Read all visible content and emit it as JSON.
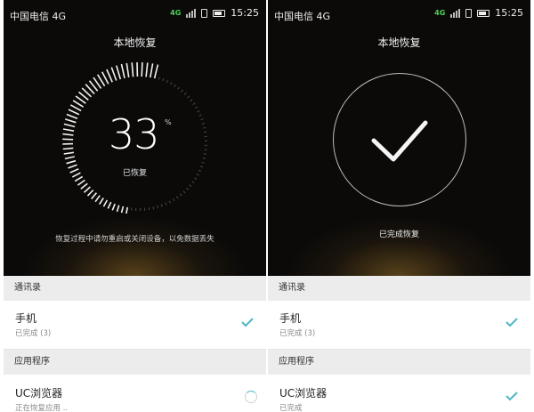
{
  "left_screen": {
    "status": {
      "carrier": "中国电信 4G",
      "network": "4G",
      "time": "15:25"
    },
    "title": "本地恢复",
    "progress": {
      "value": "33",
      "unit": "%",
      "label": "已恢复",
      "percent": 33
    },
    "warning": "恢复过程中请勿重启或关闭设备，以免数据丢失",
    "list": {
      "section1": "通讯录",
      "item1": {
        "title": "手机",
        "subtitle": "已完成 (3)"
      },
      "section2": "应用程序",
      "item2": {
        "title": "UC浏览器",
        "subtitle": "正在恢复应用 .."
      }
    }
  },
  "right_screen": {
    "status": {
      "carrier": "中国电信 4G",
      "network": "4G",
      "time": "15:25"
    },
    "title": "本地恢复",
    "done_label": "已完成恢复",
    "list": {
      "section1": "通讯录",
      "item1": {
        "title": "手机",
        "subtitle": "已完成 (3)"
      },
      "section2": "应用程序",
      "item2": {
        "title": "UC浏览器",
        "subtitle": "已完成"
      }
    }
  },
  "colors": {
    "accent": "#4db6c4",
    "dark_bg": "#0b0a09",
    "glow": "#8c6a2a"
  }
}
